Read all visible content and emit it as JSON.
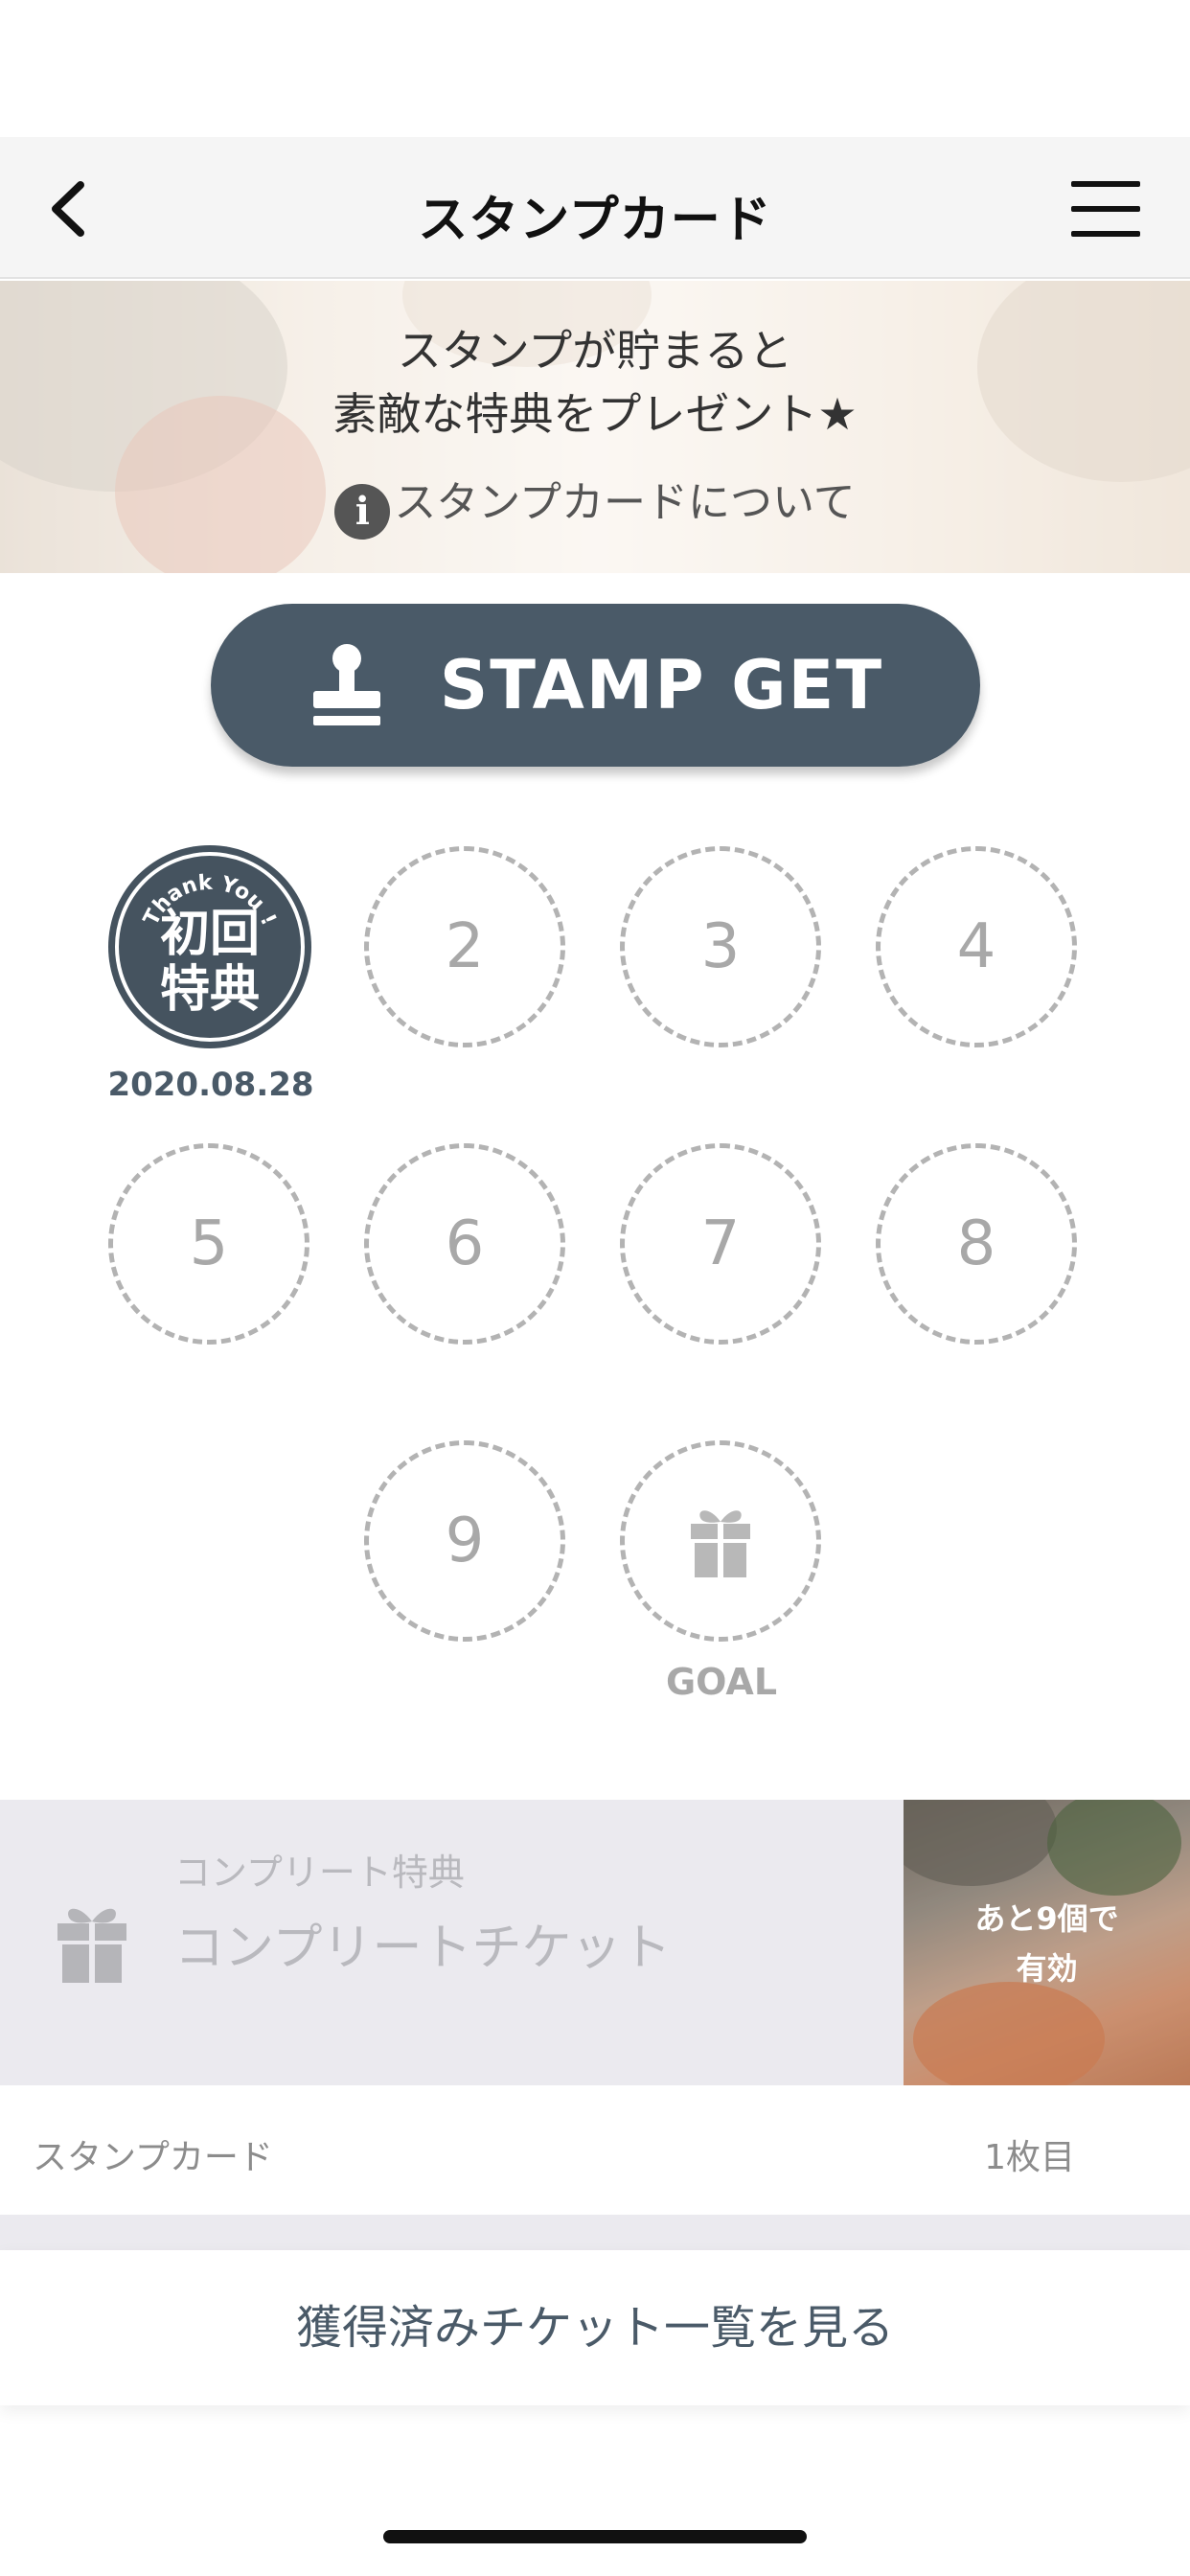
{
  "header": {
    "title": "スタンプカード",
    "back_icon": "chevron-left-icon",
    "menu_icon": "hamburger-menu-icon"
  },
  "banner": {
    "line1": "スタンプが貯まると",
    "line2": "素敵な特典をプレゼント★",
    "link_label": "スタンプカードについて",
    "info_icon_glyph": "i"
  },
  "stamp_get": {
    "label": "STAMP GET",
    "icon": "stamp-icon"
  },
  "stamps": {
    "first": {
      "arc_text": "Thank You !",
      "line1": "初回",
      "line2": "特典",
      "date": "2020.08.28"
    },
    "slots": [
      "2",
      "3",
      "4",
      "5",
      "6",
      "7",
      "8",
      "9"
    ],
    "goal_label": "GOAL",
    "goal_icon": "gift-icon"
  },
  "complete_ticket": {
    "subtitle": "コンプリート特典",
    "title": "コンプリートチケット",
    "remaining_line1": "あと9個で",
    "remaining_line2": "有効"
  },
  "card_footer": {
    "left": "スタンプカード",
    "right": "1枚目"
  },
  "ticket_list_button": "獲得済みチケット一覧を見る",
  "colors": {
    "accent": "#4a5a68",
    "slot_border": "#b3b3b3",
    "ticket_bg": "#ebeaef"
  }
}
